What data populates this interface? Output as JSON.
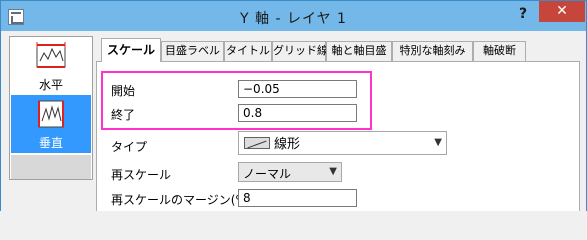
{
  "window": {
    "title": "Y 軸 - レイヤ 1",
    "help_label": "?",
    "close_label": "✕"
  },
  "sidebar": {
    "items": [
      {
        "label": "水平",
        "icon": "horizontal-axis-icon",
        "selected": false
      },
      {
        "label": "垂直",
        "icon": "vertical-axis-icon",
        "selected": true
      }
    ]
  },
  "tabs": [
    {
      "label": "スケール",
      "active": true
    },
    {
      "label": "目盛ラベル",
      "active": false
    },
    {
      "label": "タイトル",
      "active": false
    },
    {
      "label": "グリッド線",
      "active": false
    },
    {
      "label": "軸と軸目盛",
      "active": false
    },
    {
      "label": "特別な軸刻み",
      "active": false
    },
    {
      "label": "軸破断",
      "active": false
    }
  ],
  "scale": {
    "start_label": "開始",
    "start_value": "−0.05",
    "end_label": "終了",
    "end_value": "0.8",
    "type_label": "タイプ",
    "type_value": "線形",
    "type_icon": "linear-scale-icon",
    "rescale_label": "再スケール",
    "rescale_value": "ノーマル",
    "margin_label": "再スケールのマージン(%)",
    "margin_value": "8"
  },
  "colors": {
    "titlebar": "#73b8e8",
    "close_button": "#c7463c",
    "selection": "#3399ff",
    "highlight": "#ff33cc"
  }
}
